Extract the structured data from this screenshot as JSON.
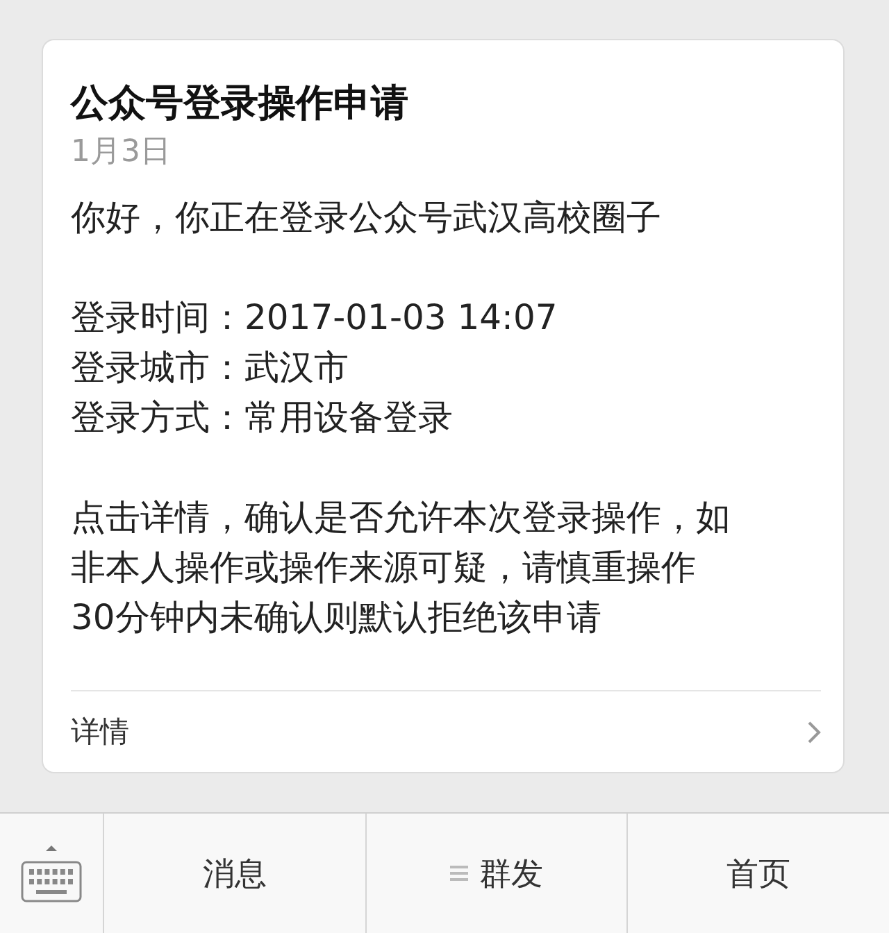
{
  "card": {
    "title": "公众号登录操作申请",
    "date": "1月3日",
    "greeting": "你好，你正在登录公众号武汉高校圈子",
    "fields": [
      {
        "label": "登录时间：",
        "value": "2017-01-03 14:07"
      },
      {
        "label": "登录城市：",
        "value": "武汉市"
      },
      {
        "label": "登录方式：",
        "value": "常用设备登录"
      }
    ],
    "notice": [
      "点击详情，确认是否允许本次登录操作，如",
      "非本人操作或操作来源可疑，请慎重操作",
      "30分钟内未确认则默认拒绝该申请"
    ],
    "link": "详情"
  },
  "menu_bar": {
    "items": [
      {
        "label": "消息",
        "has_submenu": false
      },
      {
        "label": "群发",
        "has_submenu": true
      },
      {
        "label": "首页",
        "has_submenu": false
      }
    ]
  }
}
